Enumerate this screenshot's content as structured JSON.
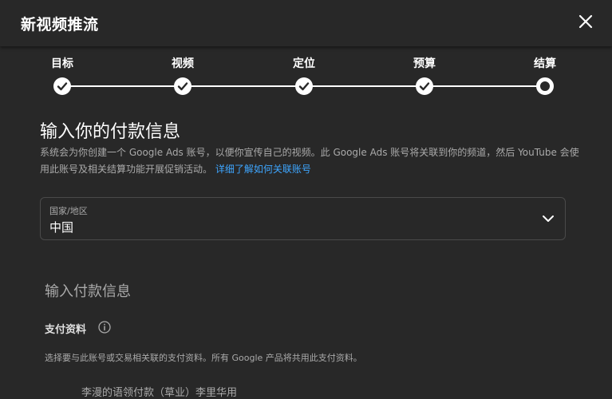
{
  "dialog": {
    "title": "新视频推流"
  },
  "steps": [
    {
      "label": "目标",
      "state": "done"
    },
    {
      "label": "视频",
      "state": "done"
    },
    {
      "label": "定位",
      "state": "done"
    },
    {
      "label": "预算",
      "state": "done"
    },
    {
      "label": "结算",
      "state": "current"
    }
  ],
  "payment": {
    "title": "输入你的付款信息",
    "description": "系统会为你创建一个 Google Ads 账号，以便你宣传自己的视频。此 Google Ads 账号将关联到你的频道，然后 YouTube 会使用此账号及相关结算功能开展促销活动。",
    "learn_more": "详细了解如何关联账号"
  },
  "country": {
    "label": "国家/地区",
    "value": "中国"
  },
  "payment_info": {
    "title": "输入付款信息",
    "profile_label": "支付资料",
    "profile_desc": "选择要与此账号或交易相关联的支付资料。所有 Google 产品将共用此支付资料。",
    "cut_text": "李漫的语领付款（草业）李里华用"
  },
  "colors": {
    "background": "#282828",
    "link": "#3ea6ff",
    "text": "#f1f1f1"
  }
}
